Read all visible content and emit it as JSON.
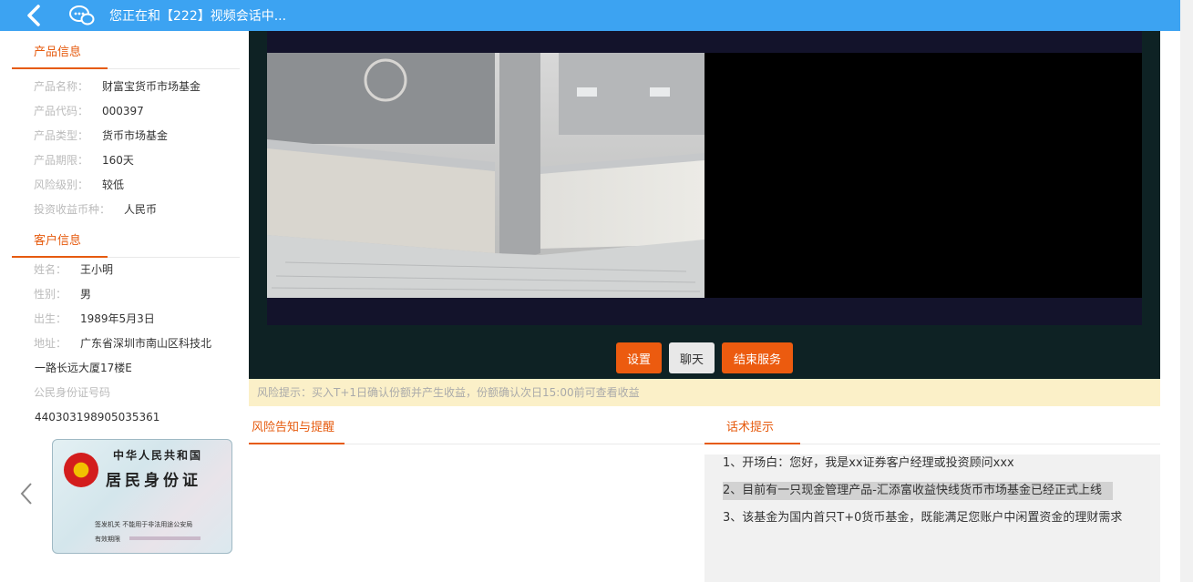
{
  "header": {
    "title": "您正在和【222】视频会话中..."
  },
  "product": {
    "section_title": "产品信息",
    "name_label": "产品名称：",
    "name": "财富宝货币市场基金",
    "code_label": "产品代码：",
    "code": "000397",
    "type_label": "产品类型：",
    "type": "货币市场基金",
    "term_label": "产品期限：",
    "term": "160天",
    "risk_label": "风险级别：",
    "risk": "较低",
    "currency_label": "投资收益币种：",
    "currency": "人民币"
  },
  "customer": {
    "section_title": "客户信息",
    "name_label": "姓名：",
    "name": "王小明",
    "gender_label": "性别：",
    "gender": "男",
    "birth_label": "出生：",
    "birth": "1989年5月3日",
    "address_label": "地址：",
    "address_line1": "广东省深圳市南山区科技北",
    "address_line2": "一路长远大厦17楼E",
    "id_label": "公民身份证号码",
    "id_number": "440303198905035361"
  },
  "id_card": {
    "line1": "中华人民共和国",
    "line2": "居民身份证",
    "issuer": "签发机关  不能用于非法用途公安局",
    "valid": "有效期限"
  },
  "controls": {
    "settings": "设置",
    "chat": "聊天",
    "end_service": "结束服务"
  },
  "risk_notice": "风险提示：买入T+1日确认份额并产生收益，份额确认次日15:00前可查看收益",
  "tabs": {
    "risk_tab": "风险告知与提醒",
    "script_tab": "话术提示"
  },
  "scripts": [
    "1、开场白：您好，我是xx证券客户经理或投资顾问xxx",
    "2、目前有一只现金管理产品-汇添富收益快线货币市场基金已经正式上线",
    "3、该基金为国内首只T+0货币基金，既能满足您账户中闲置资金的理财需求"
  ],
  "colors": {
    "header_bg": "#3ca3f2",
    "accent": "#e65b0f",
    "video_panel_bg": "#0e2224",
    "risk_bar_bg": "#fbf0c8"
  }
}
